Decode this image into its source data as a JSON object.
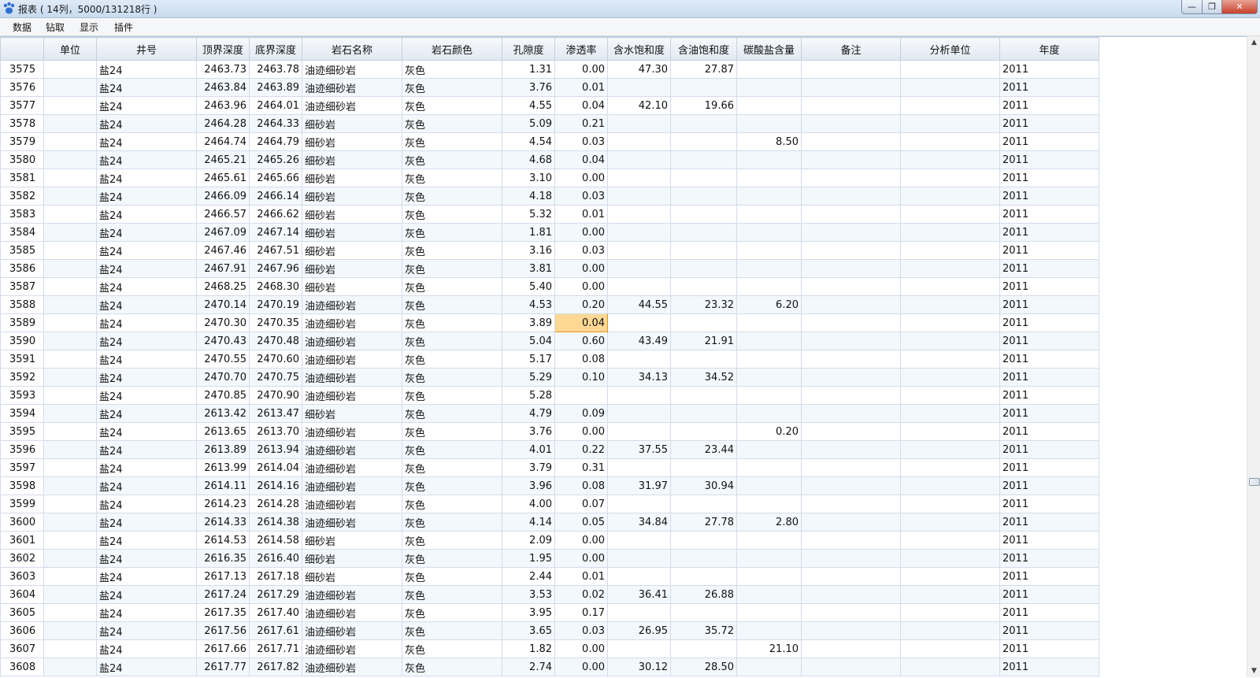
{
  "window": {
    "title": "报表 ( 14列，5000/131218行 )",
    "controls": {
      "minimize": "—",
      "maximize": "❐",
      "close": "✕"
    }
  },
  "menu": [
    "数据",
    "钻取",
    "显示",
    "插件"
  ],
  "table": {
    "columns": [
      "",
      "单位",
      "井号",
      "顶界深度",
      "底界深度",
      "岩石名称",
      "岩石颜色",
      "孔隙度",
      "渗透率",
      "含水饱和度",
      "含油饱和度",
      "碳酸盐含量",
      "备注",
      "分析单位",
      "年度"
    ],
    "selected": {
      "row": "3589",
      "column": "渗透率"
    },
    "rows": [
      [
        "3575",
        "",
        "盐24",
        "2463.73",
        "2463.78",
        "油迹细砂岩",
        "灰色",
        "1.31",
        "0.00",
        "47.30",
        "27.87",
        "",
        "",
        "",
        "2011"
      ],
      [
        "3576",
        "",
        "盐24",
        "2463.84",
        "2463.89",
        "油迹细砂岩",
        "灰色",
        "3.76",
        "0.01",
        "",
        "",
        "",
        "",
        "",
        "2011"
      ],
      [
        "3577",
        "",
        "盐24",
        "2463.96",
        "2464.01",
        "油迹细砂岩",
        "灰色",
        "4.55",
        "0.04",
        "42.10",
        "19.66",
        "",
        "",
        "",
        "2011"
      ],
      [
        "3578",
        "",
        "盐24",
        "2464.28",
        "2464.33",
        "细砂岩",
        "灰色",
        "5.09",
        "0.21",
        "",
        "",
        "",
        "",
        "",
        "2011"
      ],
      [
        "3579",
        "",
        "盐24",
        "2464.74",
        "2464.79",
        "细砂岩",
        "灰色",
        "4.54",
        "0.03",
        "",
        "",
        "8.50",
        "",
        "",
        "2011"
      ],
      [
        "3580",
        "",
        "盐24",
        "2465.21",
        "2465.26",
        "细砂岩",
        "灰色",
        "4.68",
        "0.04",
        "",
        "",
        "",
        "",
        "",
        "2011"
      ],
      [
        "3581",
        "",
        "盐24",
        "2465.61",
        "2465.66",
        "细砂岩",
        "灰色",
        "3.10",
        "0.00",
        "",
        "",
        "",
        "",
        "",
        "2011"
      ],
      [
        "3582",
        "",
        "盐24",
        "2466.09",
        "2466.14",
        "细砂岩",
        "灰色",
        "4.18",
        "0.03",
        "",
        "",
        "",
        "",
        "",
        "2011"
      ],
      [
        "3583",
        "",
        "盐24",
        "2466.57",
        "2466.62",
        "细砂岩",
        "灰色",
        "5.32",
        "0.01",
        "",
        "",
        "",
        "",
        "",
        "2011"
      ],
      [
        "3584",
        "",
        "盐24",
        "2467.09",
        "2467.14",
        "细砂岩",
        "灰色",
        "1.81",
        "0.00",
        "",
        "",
        "",
        "",
        "",
        "2011"
      ],
      [
        "3585",
        "",
        "盐24",
        "2467.46",
        "2467.51",
        "细砂岩",
        "灰色",
        "3.16",
        "0.03",
        "",
        "",
        "",
        "",
        "",
        "2011"
      ],
      [
        "3586",
        "",
        "盐24",
        "2467.91",
        "2467.96",
        "细砂岩",
        "灰色",
        "3.81",
        "0.00",
        "",
        "",
        "",
        "",
        "",
        "2011"
      ],
      [
        "3587",
        "",
        "盐24",
        "2468.25",
        "2468.30",
        "细砂岩",
        "灰色",
        "5.40",
        "0.00",
        "",
        "",
        "",
        "",
        "",
        "2011"
      ],
      [
        "3588",
        "",
        "盐24",
        "2470.14",
        "2470.19",
        "油迹细砂岩",
        "灰色",
        "4.53",
        "0.20",
        "44.55",
        "23.32",
        "6.20",
        "",
        "",
        "2011"
      ],
      [
        "3589",
        "",
        "盐24",
        "2470.30",
        "2470.35",
        "油迹细砂岩",
        "灰色",
        "3.89",
        "0.04",
        "",
        "",
        "",
        "",
        "",
        "2011"
      ],
      [
        "3590",
        "",
        "盐24",
        "2470.43",
        "2470.48",
        "油迹细砂岩",
        "灰色",
        "5.04",
        "0.60",
        "43.49",
        "21.91",
        "",
        "",
        "",
        "2011"
      ],
      [
        "3591",
        "",
        "盐24",
        "2470.55",
        "2470.60",
        "油迹细砂岩",
        "灰色",
        "5.17",
        "0.08",
        "",
        "",
        "",
        "",
        "",
        "2011"
      ],
      [
        "3592",
        "",
        "盐24",
        "2470.70",
        "2470.75",
        "油迹细砂岩",
        "灰色",
        "5.29",
        "0.10",
        "34.13",
        "34.52",
        "",
        "",
        "",
        "2011"
      ],
      [
        "3593",
        "",
        "盐24",
        "2470.85",
        "2470.90",
        "油迹细砂岩",
        "灰色",
        "5.28",
        "",
        "",
        "",
        "",
        "",
        "",
        "2011"
      ],
      [
        "3594",
        "",
        "盐24",
        "2613.42",
        "2613.47",
        "细砂岩",
        "灰色",
        "4.79",
        "0.09",
        "",
        "",
        "",
        "",
        "",
        "2011"
      ],
      [
        "3595",
        "",
        "盐24",
        "2613.65",
        "2613.70",
        "油迹细砂岩",
        "灰色",
        "3.76",
        "0.00",
        "",
        "",
        "0.20",
        "",
        "",
        "2011"
      ],
      [
        "3596",
        "",
        "盐24",
        "2613.89",
        "2613.94",
        "油迹细砂岩",
        "灰色",
        "4.01",
        "0.22",
        "37.55",
        "23.44",
        "",
        "",
        "",
        "2011"
      ],
      [
        "3597",
        "",
        "盐24",
        "2613.99",
        "2614.04",
        "油迹细砂岩",
        "灰色",
        "3.79",
        "0.31",
        "",
        "",
        "",
        "",
        "",
        "2011"
      ],
      [
        "3598",
        "",
        "盐24",
        "2614.11",
        "2614.16",
        "油迹细砂岩",
        "灰色",
        "3.96",
        "0.08",
        "31.97",
        "30.94",
        "",
        "",
        "",
        "2011"
      ],
      [
        "3599",
        "",
        "盐24",
        "2614.23",
        "2614.28",
        "油迹细砂岩",
        "灰色",
        "4.00",
        "0.07",
        "",
        "",
        "",
        "",
        "",
        "2011"
      ],
      [
        "3600",
        "",
        "盐24",
        "2614.33",
        "2614.38",
        "油迹细砂岩",
        "灰色",
        "4.14",
        "0.05",
        "34.84",
        "27.78",
        "2.80",
        "",
        "",
        "2011"
      ],
      [
        "3601",
        "",
        "盐24",
        "2614.53",
        "2614.58",
        "细砂岩",
        "灰色",
        "2.09",
        "0.00",
        "",
        "",
        "",
        "",
        "",
        "2011"
      ],
      [
        "3602",
        "",
        "盐24",
        "2616.35",
        "2616.40",
        "细砂岩",
        "灰色",
        "1.95",
        "0.00",
        "",
        "",
        "",
        "",
        "",
        "2011"
      ],
      [
        "3603",
        "",
        "盐24",
        "2617.13",
        "2617.18",
        "细砂岩",
        "灰色",
        "2.44",
        "0.01",
        "",
        "",
        "",
        "",
        "",
        "2011"
      ],
      [
        "3604",
        "",
        "盐24",
        "2617.24",
        "2617.29",
        "油迹细砂岩",
        "灰色",
        "3.53",
        "0.02",
        "36.41",
        "26.88",
        "",
        "",
        "",
        "2011"
      ],
      [
        "3605",
        "",
        "盐24",
        "2617.35",
        "2617.40",
        "油迹细砂岩",
        "灰色",
        "3.95",
        "0.17",
        "",
        "",
        "",
        "",
        "",
        "2011"
      ],
      [
        "3606",
        "",
        "盐24",
        "2617.56",
        "2617.61",
        "油迹细砂岩",
        "灰色",
        "3.65",
        "0.03",
        "26.95",
        "35.72",
        "",
        "",
        "",
        "2011"
      ],
      [
        "3607",
        "",
        "盐24",
        "2617.66",
        "2617.71",
        "油迹细砂岩",
        "灰色",
        "1.82",
        "0.00",
        "",
        "",
        "21.10",
        "",
        "",
        "2011"
      ],
      [
        "3608",
        "",
        "盐24",
        "2617.77",
        "2617.82",
        "油迹细砂岩",
        "灰色",
        "2.74",
        "0.00",
        "30.12",
        "28.50",
        "",
        "",
        "",
        "2011"
      ]
    ]
  },
  "scrollbar": {
    "up": "▲",
    "down": "▼"
  },
  "colors": {
    "selected_cell": "#fcd894",
    "selected_border": "#e8941a",
    "alt_row": "#f3f8fd",
    "header": "#e0e8f2"
  }
}
